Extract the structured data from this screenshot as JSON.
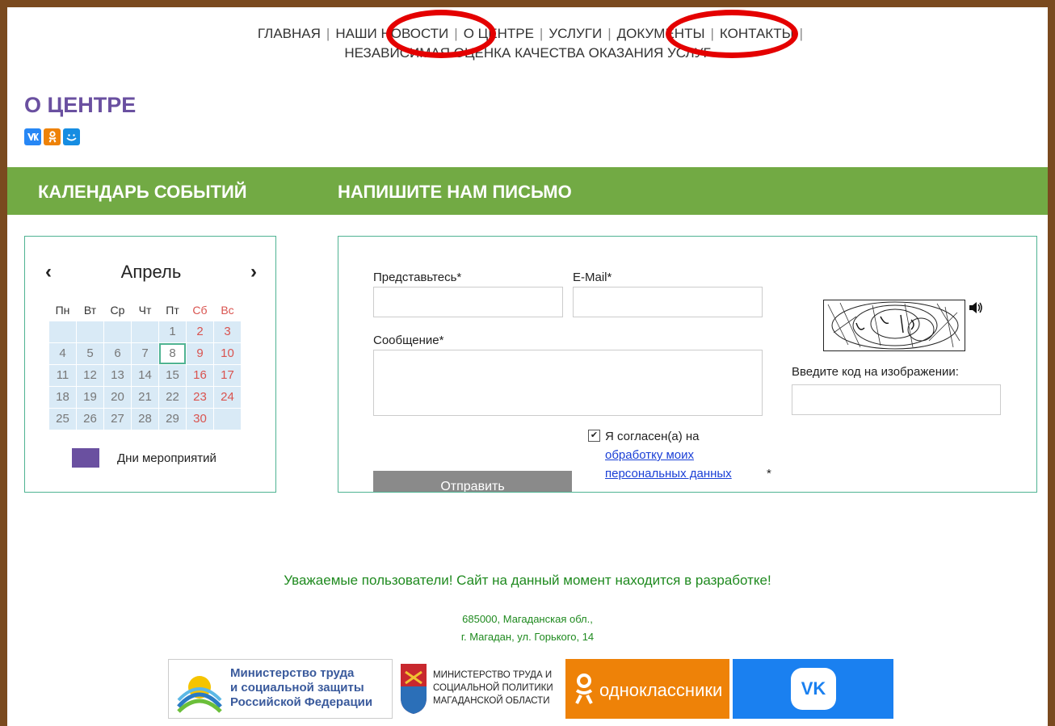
{
  "nav": {
    "row1": [
      "ГЛАВНАЯ",
      "НАШИ НОВОСТИ",
      "О ЦЕНТРЕ",
      "УСЛУГИ",
      "ДОКУМЕНТЫ",
      "КОНТАКТЫ"
    ],
    "row2": [
      "НЕЗАВИСИМАЯ ОЦЕНКА КАЧЕСТВА ОКАЗАНИЯ УСЛУГ"
    ],
    "separator": "|",
    "highlight_color": "#e40000"
  },
  "page": {
    "title": "О ЦЕНТРЕ",
    "social_icons": [
      "vk-icon",
      "ok-icon",
      "mailru-icon"
    ],
    "title_color": "#6a50a0"
  },
  "sections": {
    "calendar_heading": "КАЛЕНДАРЬ СОБЫТИЙ",
    "letter_heading": "НАПИШИТЕ НАМ ПИСЬМО",
    "bar_color": "#72aa44"
  },
  "calendar": {
    "month": "Апрель",
    "prev": "‹",
    "next": "›",
    "weekdays": [
      "Пн",
      "Вт",
      "Ср",
      "Чт",
      "Пт",
      "Сб",
      "Вс"
    ],
    "weeks": [
      [
        "",
        "",
        "",
        "",
        "1",
        "2",
        "3"
      ],
      [
        "4",
        "5",
        "6",
        "7",
        "8",
        "9",
        "10"
      ],
      [
        "11",
        "12",
        "13",
        "14",
        "15",
        "16",
        "17"
      ],
      [
        "18",
        "19",
        "20",
        "21",
        "22",
        "23",
        "24"
      ],
      [
        "25",
        "26",
        "27",
        "28",
        "29",
        "30",
        ""
      ]
    ],
    "today": "8",
    "legend_label": "Дни мероприятий",
    "legend_color": "#6a50a0"
  },
  "form": {
    "name_label": "Представьтесь*",
    "email_label": "E-Mail*",
    "message_label": "Сообщение*",
    "captcha_label": "Введите код на изображении:",
    "consent_prefix": "Я согласен(а) на",
    "consent_link": "обработку моих персональных данных",
    "consent_suffix": "*",
    "consent_checked": true,
    "submit_label": "Отправить"
  },
  "footer": {
    "notice": "Уважаемые пользователи! Сайт на данный момент находится в разработке!",
    "address_line1": "685000, Магаданская обл.,",
    "address_line2": "г. Магадан, ул. Горького, 14",
    "banners": {
      "mintrud_rf": [
        "Министерство труда",
        "и социальной защиты",
        "Российской Федерации"
      ],
      "mintrud_magadan": [
        "МИНИСТЕРСТВО ТРУДА И",
        "СОЦИАЛЬНОЙ ПОЛИТИКИ",
        "МАГАДАНСКОЙ ОБЛАСТИ"
      ],
      "ok": "одноклассники",
      "vk": "VK"
    }
  }
}
